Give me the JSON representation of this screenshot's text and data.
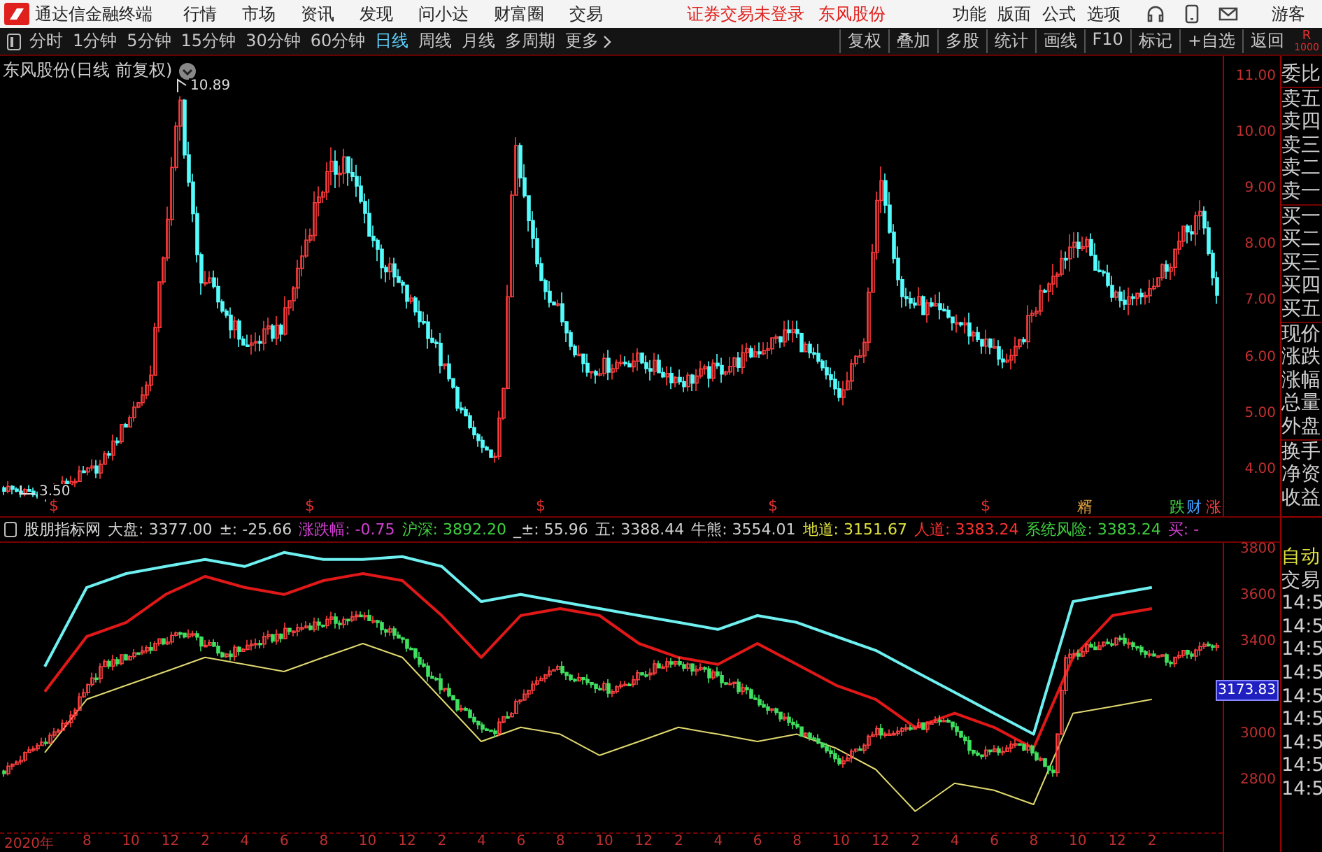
{
  "top_bar": {
    "app_name": "通达信金融终端",
    "menu": [
      "行情",
      "市场",
      "资讯",
      "发现",
      "问小达",
      "财富圈",
      "交易"
    ],
    "notices": [
      "证券交易未登录",
      "东风股份"
    ],
    "tools": [
      "功能",
      "版面",
      "公式",
      "选项"
    ],
    "user": "游客"
  },
  "toolbar": {
    "periods": [
      {
        "label": "分时",
        "selected": false
      },
      {
        "label": "1分钟",
        "selected": false
      },
      {
        "label": "5分钟",
        "selected": false
      },
      {
        "label": "15分钟",
        "selected": false
      },
      {
        "label": "30分钟",
        "selected": false
      },
      {
        "label": "60分钟",
        "selected": false
      },
      {
        "label": "日线",
        "selected": true
      },
      {
        "label": "周线",
        "selected": false
      },
      {
        "label": "月线",
        "selected": false
      },
      {
        "label": "多周期",
        "selected": false
      },
      {
        "label": "更多",
        "selected": false
      }
    ],
    "actions": [
      "复权",
      "叠加",
      "多股",
      "统计",
      "画线",
      "F10",
      "标记",
      "+自选",
      "返回"
    ],
    "corner": [
      "R",
      "1000"
    ]
  },
  "price_chart": {
    "title": "东风股份(日线 前复权)",
    "high_label": "10.89",
    "low_label": "3.50",
    "yticks": [
      "11.00",
      "10.00",
      "9.00",
      "8.00",
      "7.00",
      "6.00",
      "5.00",
      "4.00"
    ],
    "event_marks": [
      {
        "label": "$",
        "color": "#e03030"
      },
      {
        "label": "$",
        "color": "#e03030"
      },
      {
        "label": "$",
        "color": "#e03030"
      },
      {
        "label": "$",
        "color": "#e03030"
      },
      {
        "label": "$",
        "color": "#e03030"
      },
      {
        "label": "糈",
        "color": "#e0a040"
      },
      {
        "label": "跌",
        "color": "#40d040"
      },
      {
        "label": "财",
        "color": "#40a0ff"
      },
      {
        "label": "涨",
        "color": "#ff4040"
      }
    ]
  },
  "side_quote": {
    "labels": [
      "委比",
      "卖五",
      "卖四",
      "卖三",
      "卖二",
      "卖一",
      "买一",
      "买二",
      "买三",
      "买四",
      "买五",
      "现价",
      "涨跌",
      "涨幅",
      "总量",
      "外盘",
      "换手",
      "净资",
      "收益"
    ]
  },
  "indicator": {
    "name": "股朋指标网",
    "items": [
      {
        "text": "大盘: 3377.00",
        "color": "#d0d0d0"
      },
      {
        "text": "±: -25.66",
        "color": "#d0d0d0"
      },
      {
        "text": "涨跌幅: -0.75",
        "color": "#d040d0"
      },
      {
        "text": "沪深: 3892.20",
        "color": "#40d040"
      },
      {
        "text": "_±: 55.96",
        "color": "#d0d0d0"
      },
      {
        "text": "五: 3388.44",
        "color": "#d0d0d0"
      },
      {
        "text": "牛熊: 3554.01",
        "color": "#d0d0d0"
      },
      {
        "text": "地道: 3151.67",
        "color": "#e0e040"
      },
      {
        "text": "人道: 3383.24",
        "color": "#ff3030"
      },
      {
        "text": "系统风险: 3383.24",
        "color": "#40d040"
      },
      {
        "text": "买: -",
        "color": "#d040d0"
      }
    ]
  },
  "index_chart": {
    "current_value": "3173.83",
    "chart_data": {
      "type": "line",
      "categories": [
        "2020年",
        "8",
        "10",
        "12",
        "2",
        "4",
        "6",
        "8",
        "10",
        "12",
        "2",
        "4",
        "6",
        "8",
        "10",
        "12",
        "2",
        "4",
        "6",
        "8",
        "10",
        "12",
        "2",
        "4",
        "6",
        "8",
        "10",
        "12",
        "2"
      ],
      "ylim": [
        2585,
        3836
      ],
      "yticks": [
        3800,
        3600,
        3400,
        3000,
        2800
      ],
      "series": [
        {
          "color": "#e0d870",
          "values": [
            2930,
            3160,
            3220,
            3280,
            3341,
            3311,
            3280,
            3341,
            3401,
            3341,
            3160,
            2978,
            3039,
            3009,
            2918,
            2978,
            3039,
            3009,
            2978,
            3009,
            2948,
            2857,
            2676,
            2797,
            2767,
            2706,
            3099,
            3129,
            3160
          ]
        },
        {
          "color": "#6ef0f0",
          "values": [
            3301,
            3643,
            3703,
            3734,
            3764,
            3734,
            3794,
            3764,
            3764,
            3776,
            3734,
            3582,
            3613,
            3582,
            3552,
            3522,
            3492,
            3462,
            3522,
            3492,
            3431,
            3371,
            3280,
            3190,
            3099,
            3009,
            3582,
            3613,
            3643
          ]
        },
        {
          "color": "#e01818",
          "values": [
            3193,
            3431,
            3492,
            3613,
            3691,
            3643,
            3613,
            3673,
            3703,
            3673,
            3522,
            3341,
            3522,
            3552,
            3522,
            3401,
            3341,
            3311,
            3401,
            3311,
            3220,
            3160,
            3039,
            3100,
            3039,
            2948,
            3341,
            3522,
            3552
          ]
        }
      ]
    }
  },
  "side_trades": {
    "items": [
      {
        "text": "自动",
        "color": "#e0e040"
      },
      {
        "text": "交易",
        "color": "#d0d0d0"
      },
      {
        "text": "14:5",
        "color": "#d0d0d0"
      },
      {
        "text": "14:5",
        "color": "#d0d0d0"
      },
      {
        "text": "14:5",
        "color": "#d0d0d0"
      },
      {
        "text": "14:5",
        "color": "#d0d0d0"
      },
      {
        "text": "14:5",
        "color": "#d0d0d0"
      },
      {
        "text": "14:5",
        "color": "#d0d0d0"
      },
      {
        "text": "14:5",
        "color": "#d0d0d0"
      },
      {
        "text": "14:5",
        "color": "#d0d0d0"
      },
      {
        "text": "14:5",
        "color": "#d0d0d0"
      }
    ]
  }
}
